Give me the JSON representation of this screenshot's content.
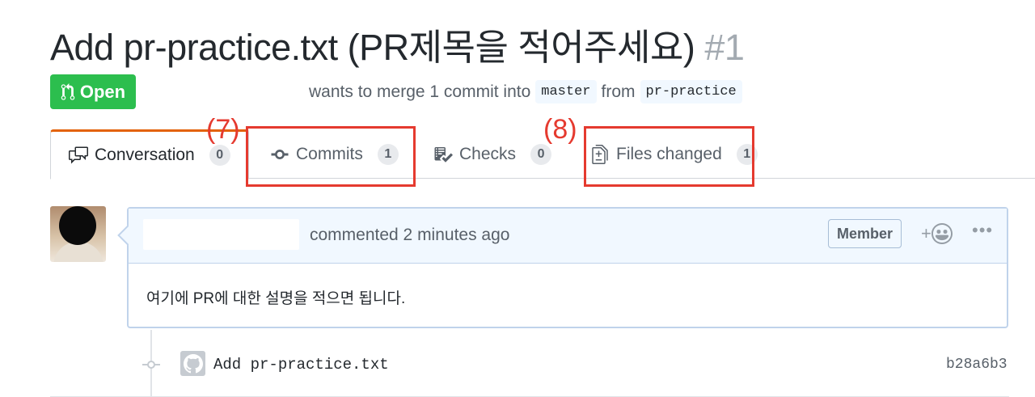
{
  "pr": {
    "title": "Add pr-practice.txt (PR제목을 적어주세요)",
    "number": "#1",
    "state": "Open",
    "merge_prefix": "wants to merge 1 commit into",
    "base_branch": "master",
    "from_word": "from",
    "head_branch": "pr-practice"
  },
  "tabs": [
    {
      "label": "Conversation",
      "count": "0",
      "icon": "comment-discussion-icon"
    },
    {
      "label": "Commits",
      "count": "1",
      "icon": "git-commit-icon"
    },
    {
      "label": "Checks",
      "count": "0",
      "icon": "checklist-icon"
    },
    {
      "label": "Files changed",
      "count": "1",
      "icon": "file-diff-icon"
    }
  ],
  "annotations": {
    "commits_label": "(7)",
    "files_label": "(8)",
    "color": "#e53a2f"
  },
  "comment": {
    "action": "commented 2 minutes ago",
    "role": "Member",
    "reaction_plus": "+",
    "more": "•••",
    "body": "여기에 PR에 대한 설명을 적으면 됩니다."
  },
  "commit": {
    "message": "Add pr-practice.txt",
    "sha": "b28a6b3"
  },
  "colors": {
    "open_green": "#2cbe4e",
    "header_bg": "#f1f8ff",
    "border_blue": "#c0d3eb"
  }
}
